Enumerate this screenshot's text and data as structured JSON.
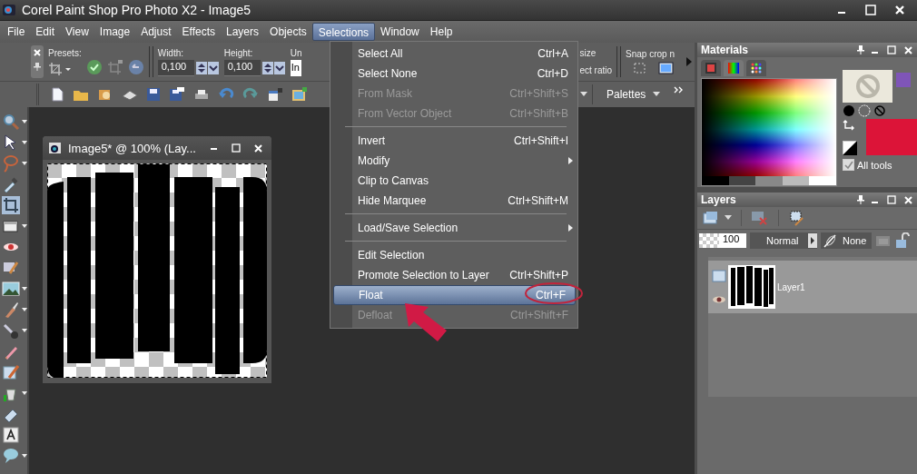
{
  "window": {
    "title": "Corel Paint Shop Pro Photo X2 - Image5"
  },
  "menu_bar": [
    {
      "label": "File",
      "selected": false
    },
    {
      "label": "Edit",
      "selected": false
    },
    {
      "label": "View",
      "selected": false
    },
    {
      "label": "Image",
      "selected": false
    },
    {
      "label": "Adjust",
      "selected": false
    },
    {
      "label": "Effects",
      "selected": false
    },
    {
      "label": "Layers",
      "selected": false
    },
    {
      "label": "Objects",
      "selected": false
    },
    {
      "label": "Selections",
      "selected": true
    },
    {
      "label": "Window",
      "selected": false
    },
    {
      "label": "Help",
      "selected": false
    }
  ],
  "tool_options": {
    "presets_label": "Presets:",
    "width_label": "Width:",
    "width_value": "0,100",
    "height_label": "Height:",
    "height_value": "0,100",
    "units_label": "Un",
    "units_value": "In",
    "size_label": "size",
    "ratio_label": "ect ratio",
    "snap_label": "Snap crop n"
  },
  "standard_toolbar": {
    "palettes": "Palettes"
  },
  "tools": [
    {
      "kind": "zoom",
      "selected": false
    },
    {
      "kind": "pointer",
      "selected": false
    },
    {
      "kind": "lasso",
      "selected": false
    },
    {
      "kind": "dropper",
      "selected": false
    },
    {
      "kind": "crop",
      "selected": true
    },
    {
      "kind": "frame",
      "selected": false
    },
    {
      "kind": "eye",
      "selected": false
    },
    {
      "kind": "stamp",
      "selected": false
    },
    {
      "kind": "scene",
      "selected": false
    },
    {
      "kind": "brush",
      "selected": false
    },
    {
      "kind": "wand",
      "selected": false
    },
    {
      "kind": "pencil",
      "selected": false
    },
    {
      "kind": "retouch",
      "selected": false
    },
    {
      "kind": "bucket",
      "selected": false
    },
    {
      "kind": "eraser",
      "selected": false
    },
    {
      "kind": "text",
      "selected": false
    },
    {
      "kind": "bubble",
      "selected": false
    }
  ],
  "selections_menu": [
    {
      "kind": "item",
      "label": "Select All",
      "shortcut": "Ctrl+A",
      "disabled": false,
      "selected": false,
      "submenu": false
    },
    {
      "kind": "item",
      "label": "Select None",
      "shortcut": "Ctrl+D",
      "disabled": false,
      "selected": false,
      "submenu": false
    },
    {
      "kind": "item",
      "label": "From Mask",
      "shortcut": "Ctrl+Shift+S",
      "disabled": true,
      "selected": false,
      "submenu": false
    },
    {
      "kind": "item",
      "label": "From Vector Object",
      "shortcut": "Ctrl+Shift+B",
      "disabled": true,
      "selected": false,
      "submenu": false
    },
    {
      "kind": "separator"
    },
    {
      "kind": "item",
      "label": "Invert",
      "shortcut": "Ctrl+Shift+I",
      "disabled": false,
      "selected": false,
      "submenu": false
    },
    {
      "kind": "item",
      "label": "Modify",
      "disabled": false,
      "selected": false,
      "submenu": true
    },
    {
      "kind": "item",
      "label": "Clip to Canvas",
      "disabled": false,
      "selected": false,
      "submenu": false
    },
    {
      "kind": "item",
      "label": "Hide Marquee",
      "shortcut": "Ctrl+Shift+M",
      "disabled": false,
      "selected": false,
      "submenu": false
    },
    {
      "kind": "separator"
    },
    {
      "kind": "item",
      "label": "Load/Save Selection",
      "disabled": false,
      "selected": false,
      "submenu": true
    },
    {
      "kind": "separator"
    },
    {
      "kind": "item",
      "label": "Edit Selection",
      "disabled": false,
      "selected": false,
      "submenu": false
    },
    {
      "kind": "item",
      "label": "Promote Selection to Layer",
      "shortcut": "Ctrl+Shift+P",
      "disabled": false,
      "selected": false,
      "submenu": false
    },
    {
      "kind": "item",
      "label": "Float",
      "shortcut": "Ctrl+F",
      "disabled": false,
      "selected": true,
      "submenu": false
    },
    {
      "kind": "item",
      "label": "Defloat",
      "shortcut": "Ctrl+Shift+F",
      "disabled": true,
      "selected": false,
      "submenu": false
    }
  ],
  "image_window": {
    "title": "Image5* @ 100% (Lay..."
  },
  "materials": {
    "title": "Materials",
    "all_tools": {
      "label": "All tools",
      "checked": true
    }
  },
  "layers_palette": {
    "title": "Layers",
    "opacity": "100",
    "blend_mode": "Normal",
    "mask_mode": "None",
    "layers": [
      {
        "name": "Layer1",
        "selected": true
      }
    ]
  }
}
